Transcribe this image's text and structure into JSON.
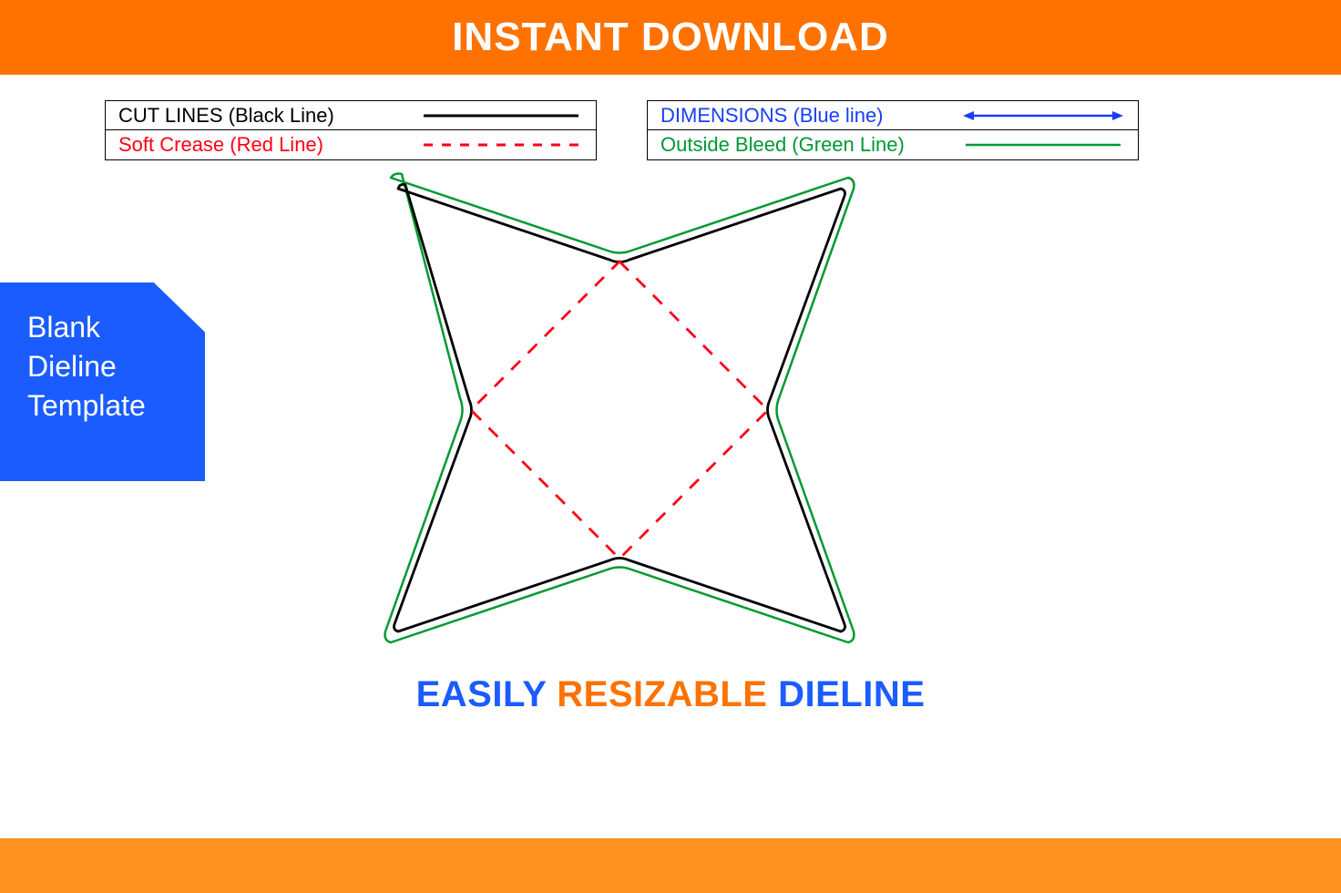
{
  "header": {
    "title": "INSTANT DOWNLOAD"
  },
  "legend": {
    "left": [
      {
        "label": "CUT LINES (Black Line)"
      },
      {
        "label": "Soft Crease (Red Line)"
      }
    ],
    "right": [
      {
        "label": "DIMENSIONS (Blue line)"
      },
      {
        "label": "Outside Bleed (Green Line)"
      }
    ]
  },
  "badge": {
    "line1": "Blank",
    "line2": "Dieline",
    "line3": "Template"
  },
  "tagline": {
    "word1": "EASILY",
    "word2": "RESIZABLE",
    "word3": "DIELINE"
  },
  "colors": {
    "orange": "#ff7200",
    "orange_light": "#ff9120",
    "blue": "#1a5cff",
    "red": "#ff0015",
    "green": "#009933",
    "black": "#000000"
  }
}
